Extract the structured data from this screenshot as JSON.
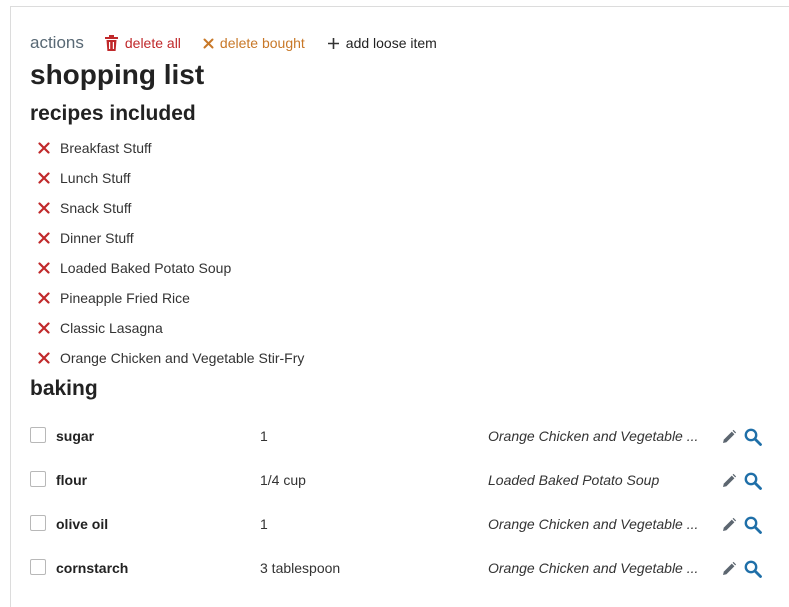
{
  "actions": {
    "label": "actions",
    "delete_all": "delete all",
    "delete_bought": "delete bought",
    "add_loose": "add loose item"
  },
  "page": {
    "title": "shopping list",
    "recipes_heading": "recipes included",
    "category_heading": "baking"
  },
  "recipes": [
    "Breakfast Stuff",
    "Lunch Stuff",
    "Snack Stuff",
    "Dinner Stuff",
    "Loaded Baked Potato Soup",
    "Pineapple Fried Rice",
    "Classic Lasagna",
    "Orange Chicken and Vegetable Stir-Fry"
  ],
  "items": [
    {
      "name": "sugar",
      "qty": "1",
      "recipe": "Orange Chicken and Vegetable ..."
    },
    {
      "name": "flour",
      "qty": "1/4 cup",
      "recipe": "Loaded Baked Potato Soup"
    },
    {
      "name": "olive oil",
      "qty": "1",
      "recipe": "Orange Chicken and Vegetable ..."
    },
    {
      "name": "cornstarch",
      "qty": "3 tablespoon",
      "recipe": "Orange Chicken and Vegetable ..."
    }
  ],
  "icons": {
    "delete_all": "trash-icon",
    "delete_bought": "close-icon",
    "add_loose": "plus-icon",
    "remove_recipe": "close-icon",
    "edit": "pencil-icon",
    "search": "search-icon"
  },
  "colors": {
    "danger": "#c0292b",
    "warning": "#c87828",
    "search": "#1f6fa8",
    "heading": "#586874"
  }
}
